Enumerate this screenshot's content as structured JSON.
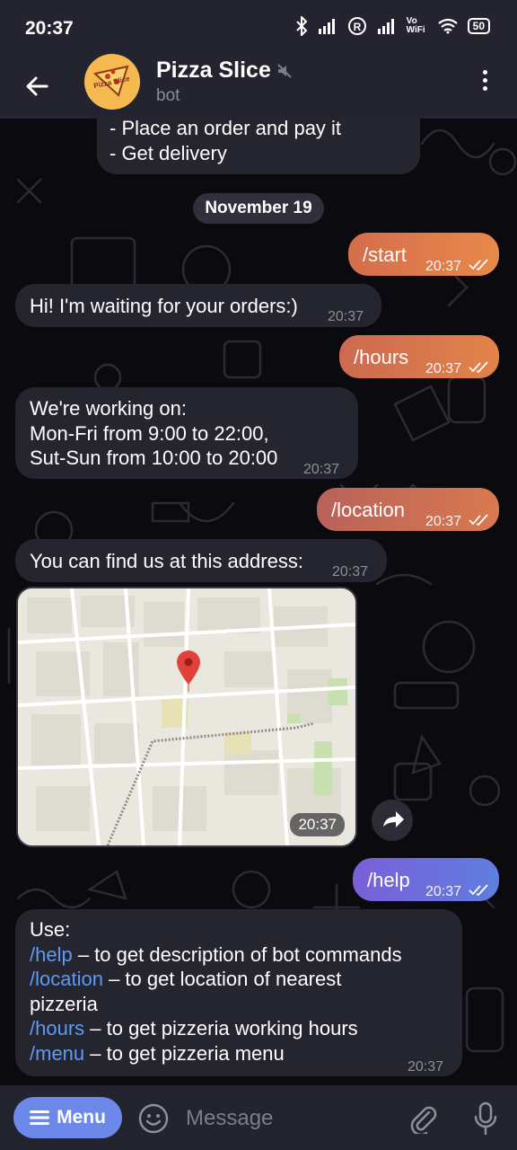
{
  "status_bar": {
    "time": "20:37",
    "battery": "50",
    "icons": [
      "bluetooth-icon",
      "signal-icon",
      "r-icon",
      "signal-icon",
      "vowifi-icon",
      "wifi-icon",
      "battery-icon"
    ],
    "vowifi": "Vo WiFi"
  },
  "header": {
    "title": "Pizza Slice",
    "subtitle": "bot",
    "avatar_text": "Pizza Slice"
  },
  "colors": {
    "out_gradient_start": "#c9684f",
    "out_gradient_end": "#e8894a",
    "in_bubble": "#24252e",
    "link": "#5d9bf5",
    "menu_button": "#6c88e8"
  },
  "messages": [
    {
      "id": "m0",
      "dir": "in",
      "lines": [
        "- Place an order and pay it",
        "- Get delivery"
      ]
    },
    {
      "id": "date",
      "text": "November 19"
    },
    {
      "id": "m1",
      "dir": "out",
      "text": "/start",
      "time": "20:37"
    },
    {
      "id": "m2",
      "dir": "in",
      "text": "Hi! I'm waiting for your orders:)",
      "time": "20:37"
    },
    {
      "id": "m3",
      "dir": "out",
      "text": "/hours",
      "time": "20:37"
    },
    {
      "id": "m4",
      "dir": "in",
      "lines": [
        "We're working on:",
        "Mon-Fri from 9:00 to 22:00,",
        "Sut-Sun from 10:00 to 20:00"
      ],
      "time": "20:37"
    },
    {
      "id": "m5",
      "dir": "out",
      "text": "/location",
      "time": "20:37"
    },
    {
      "id": "m6",
      "dir": "in",
      "text": "You can find us at this address:",
      "time": "20:37"
    },
    {
      "id": "m7",
      "dir": "in",
      "type": "map",
      "time": "20:37"
    },
    {
      "id": "m8",
      "dir": "out",
      "text": "/help",
      "time": "20:37"
    },
    {
      "id": "m9",
      "dir": "in",
      "time": "20:37",
      "intro": "Use:",
      "commands": [
        {
          "cmd": "/help",
          "desc": " – to get description of bot commands"
        },
        {
          "cmd": "/location",
          "desc": " – to get location of nearest"
        },
        {
          "cmd": "",
          "desc": "pizzeria"
        },
        {
          "cmd": "/hours",
          "desc": " – to get pizzeria working hours"
        },
        {
          "cmd": "/menu",
          "desc": " – to get pizzeria menu"
        }
      ]
    }
  ],
  "composer": {
    "menu_label": "Menu",
    "placeholder": "Message"
  }
}
